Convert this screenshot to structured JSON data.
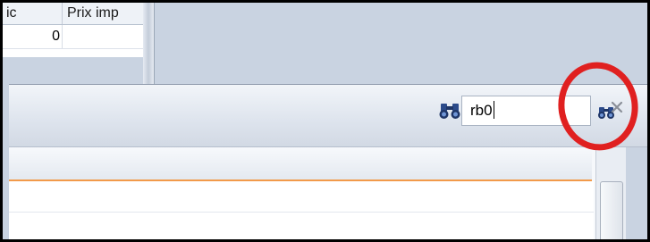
{
  "grid": {
    "columns": [
      "ic",
      "Prix imp"
    ],
    "rows": [
      [
        "0",
        ""
      ]
    ]
  },
  "search": {
    "value": "rb0"
  },
  "icons": {
    "search": "binoculars-icon",
    "clear": "binoculars-clear-icon"
  },
  "colors": {
    "accent": "#f29a4a",
    "annotation": "#e02020",
    "background": "#c9d3e1"
  }
}
